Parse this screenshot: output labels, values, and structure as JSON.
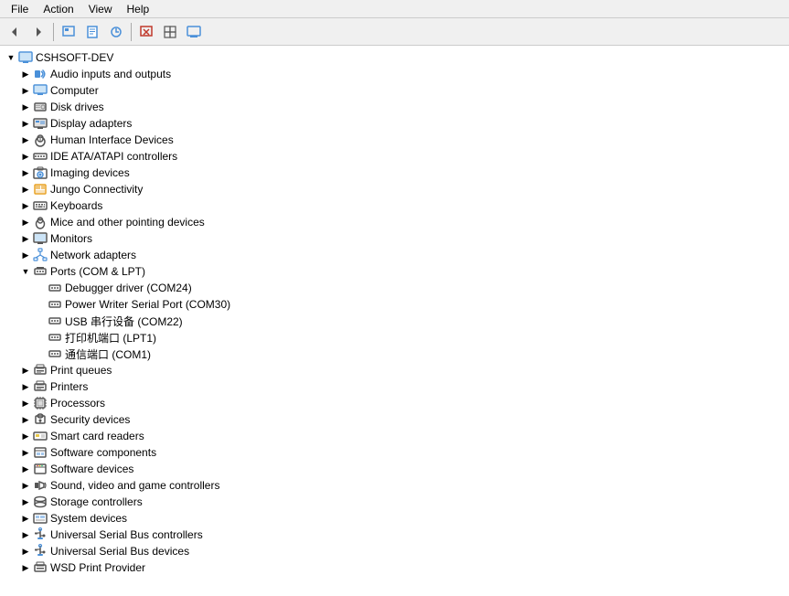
{
  "menu": {
    "items": [
      "File",
      "Action",
      "View",
      "Help"
    ]
  },
  "toolbar": {
    "buttons": [
      {
        "name": "back",
        "icon": "◀",
        "disabled": false
      },
      {
        "name": "forward",
        "icon": "▶",
        "disabled": false
      },
      {
        "name": "show-hide",
        "icon": "□",
        "disabled": false
      },
      {
        "name": "properties",
        "icon": "ℹ",
        "disabled": false
      },
      {
        "name": "update",
        "icon": "↻",
        "disabled": false
      },
      {
        "name": "uninstall",
        "icon": "✕",
        "disabled": false
      },
      {
        "name": "scan",
        "icon": "⊞",
        "disabled": false
      },
      {
        "name": "display",
        "icon": "▦",
        "disabled": false
      }
    ]
  },
  "tree": {
    "root": {
      "label": "CSHSOFT-DEV",
      "expanded": true,
      "children": [
        {
          "label": "Audio inputs and outputs",
          "expanded": false,
          "indent": 1
        },
        {
          "label": "Computer",
          "expanded": false,
          "indent": 1
        },
        {
          "label": "Disk drives",
          "expanded": false,
          "indent": 1
        },
        {
          "label": "Display adapters",
          "expanded": false,
          "indent": 1
        },
        {
          "label": "Human Interface Devices",
          "expanded": false,
          "indent": 1
        },
        {
          "label": "IDE ATA/ATAPI controllers",
          "expanded": false,
          "indent": 1
        },
        {
          "label": "Imaging devices",
          "expanded": false,
          "indent": 1
        },
        {
          "label": "Jungo Connectivity",
          "expanded": false,
          "indent": 1
        },
        {
          "label": "Keyboards",
          "expanded": false,
          "indent": 1
        },
        {
          "label": "Mice and other pointing devices",
          "expanded": false,
          "indent": 1
        },
        {
          "label": "Monitors",
          "expanded": false,
          "indent": 1
        },
        {
          "label": "Network adapters",
          "expanded": false,
          "indent": 1
        },
        {
          "label": "Ports (COM & LPT)",
          "expanded": true,
          "indent": 1,
          "children": [
            {
              "label": "Debugger driver (COM24)",
              "indent": 2
            },
            {
              "label": "Power Writer Serial Port (COM30)",
              "indent": 2
            },
            {
              "label": "USB 串行设备 (COM22)",
              "indent": 2
            },
            {
              "label": "打印机端口 (LPT1)",
              "indent": 2
            },
            {
              "label": "通信端口 (COM1)",
              "indent": 2
            }
          ]
        },
        {
          "label": "Print queues",
          "expanded": false,
          "indent": 1
        },
        {
          "label": "Printers",
          "expanded": false,
          "indent": 1
        },
        {
          "label": "Processors",
          "expanded": false,
          "indent": 1
        },
        {
          "label": "Security devices",
          "expanded": false,
          "indent": 1
        },
        {
          "label": "Smart card readers",
          "expanded": false,
          "indent": 1
        },
        {
          "label": "Software components",
          "expanded": false,
          "indent": 1
        },
        {
          "label": "Software devices",
          "expanded": false,
          "indent": 1
        },
        {
          "label": "Sound, video and game controllers",
          "expanded": false,
          "indent": 1
        },
        {
          "label": "Storage controllers",
          "expanded": false,
          "indent": 1
        },
        {
          "label": "System devices",
          "expanded": false,
          "indent": 1
        },
        {
          "label": "Universal Serial Bus controllers",
          "expanded": false,
          "indent": 1
        },
        {
          "label": "Universal Serial Bus devices",
          "expanded": false,
          "indent": 1
        },
        {
          "label": "WSD Print Provider",
          "expanded": false,
          "indent": 1
        }
      ]
    }
  },
  "icons": {
    "computer": "🖥",
    "audio": "🔊",
    "disk": "💾",
    "display": "🖥",
    "hid": "🖱",
    "ide": "🔌",
    "imaging": "📷",
    "keyboard": "⌨",
    "mice": "🖱",
    "monitor": "🖥",
    "network": "🌐",
    "ports": "🔌",
    "print": "🖨",
    "processor": "⚙",
    "security": "🔒",
    "smartcard": "💳",
    "software": "📦",
    "sound": "🎵",
    "storage": "💾",
    "system": "⚙",
    "usb": "🔌",
    "wsd": "🖨"
  }
}
